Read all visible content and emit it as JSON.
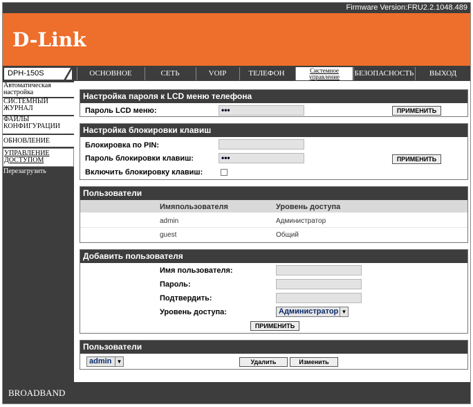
{
  "firmware": "Firmware Version:FRU2.2.1048.489",
  "brand": "D-Link",
  "model": "DPH-150S",
  "tabs": [
    "ОСНОВНОЕ",
    "СЕТЬ",
    "VOIP",
    "ТЕЛЕФОН",
    "Системное управление",
    "БЕЗОПАСНОСТЬ",
    "ВЫХОД"
  ],
  "active_tab": "Системное управление",
  "sidebar": [
    "Автоматическая настройка",
    "СИСТЕМНЫЙ ЖУРНАЛ",
    "ФАЙЛЫ КОНФИГУРАЦИИ",
    "ОБНОВЛЕНИЕ",
    "УПРАВЛЕНИЕ ДОСТУПОМ",
    "Перезагрузить"
  ],
  "lcd": {
    "title": "Настройка пароля к LCD меню телефона",
    "label": "Пароль LCD меню:",
    "value": "•••",
    "apply": "ПРИМЕНИТЬ"
  },
  "keylock": {
    "title": "Настройка блокировки клавиш",
    "pin_label": "Блокировка по PIN:",
    "pass_label": "Пароль блокировки клавиш:",
    "pass_value": "•••",
    "enable_label": "Включить блокировку клавиш:",
    "apply": "ПРИМЕНИТЬ"
  },
  "users": {
    "title": "Пользователи",
    "col_user": "Имяпользователя",
    "col_level": "Уровень доступа",
    "rows": [
      {
        "name": "admin",
        "level": "Администратор"
      },
      {
        "name": "guest",
        "level": "Общий"
      }
    ]
  },
  "add_user": {
    "title": "Добавить пользователя",
    "name_label": "Имя пользователя:",
    "pass_label": "Пароль:",
    "confirm_label": "Подтвердить:",
    "level_label": "Уровень доступа:",
    "level_value": "Администратор",
    "apply": "ПРИМЕНИТЬ"
  },
  "manage": {
    "title": "Пользователи",
    "selected": "admin",
    "delete": "Удалить",
    "edit": "Изменить"
  },
  "footer": "BROADBAND"
}
